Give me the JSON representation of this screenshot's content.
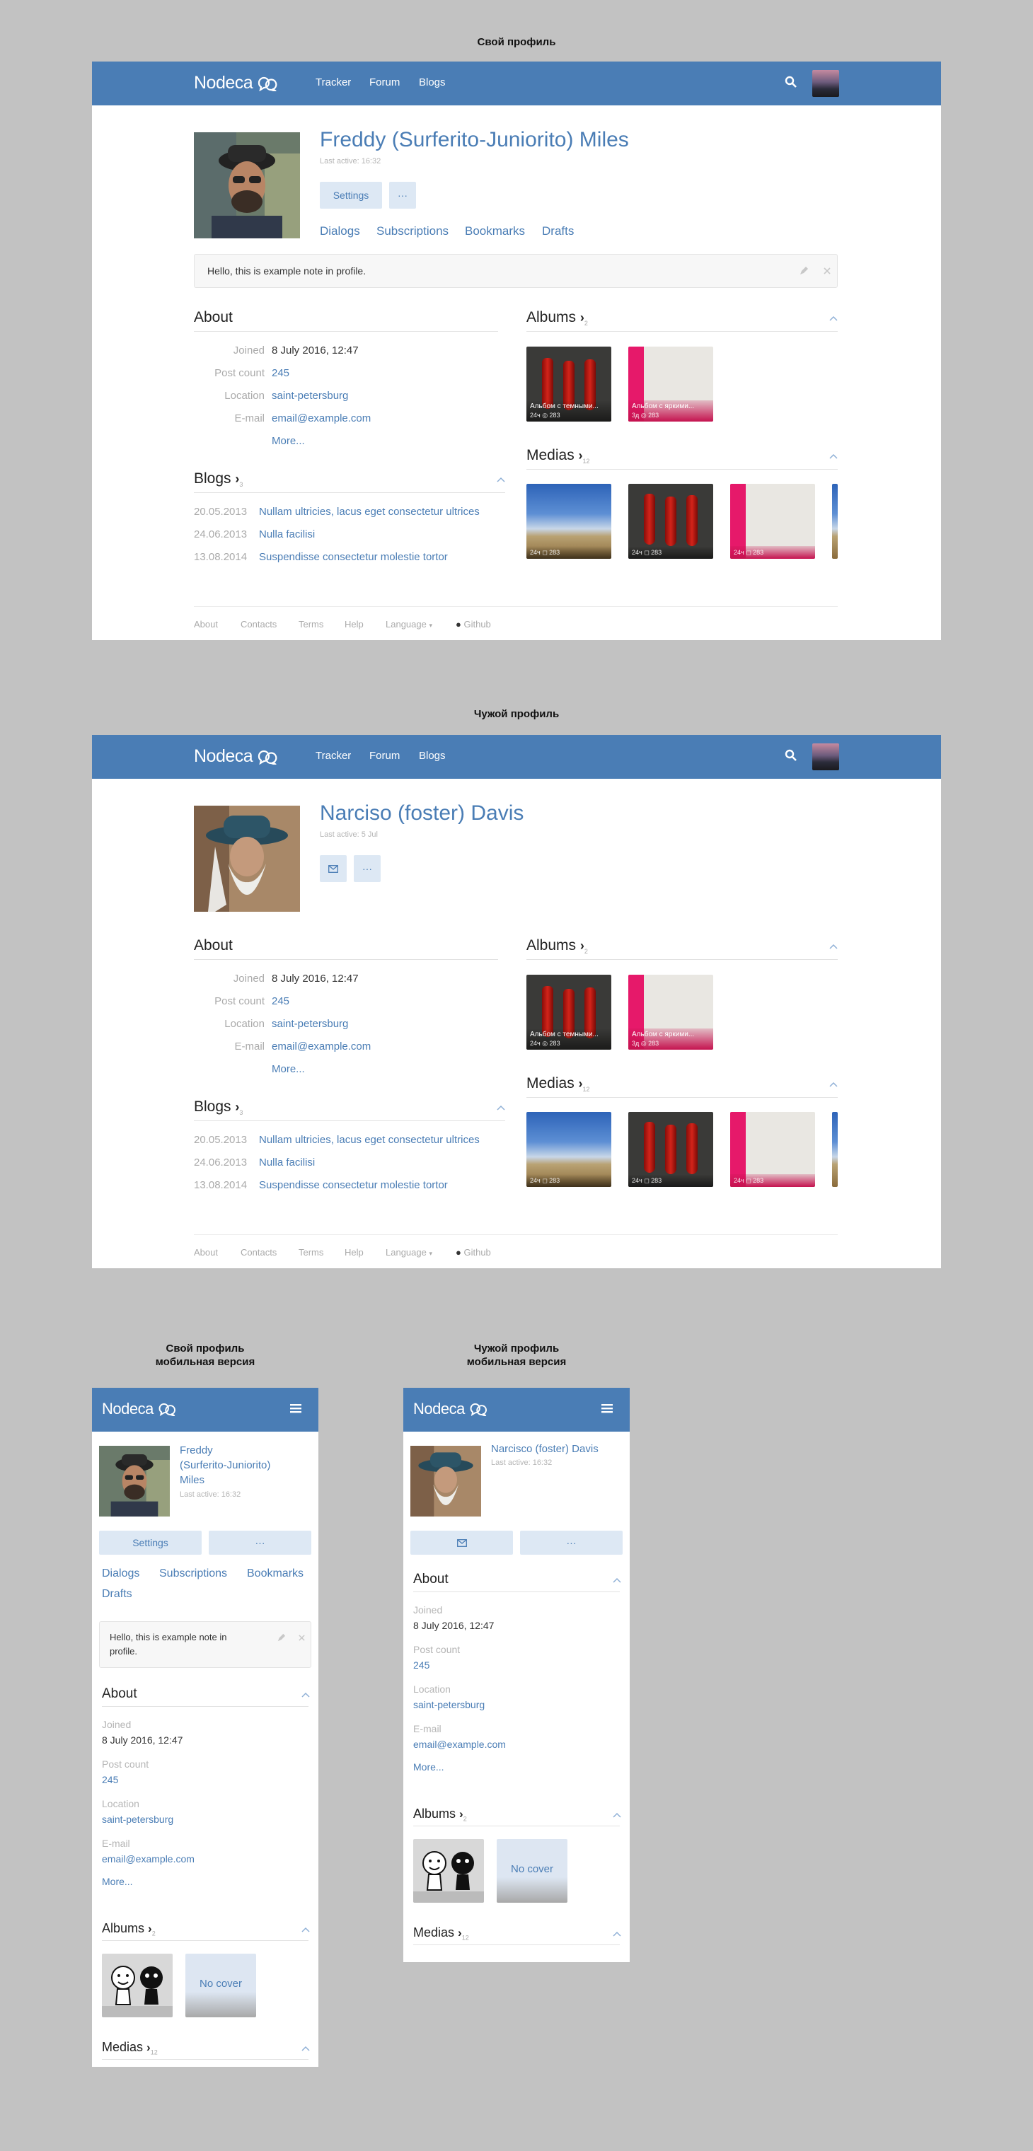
{
  "captions": {
    "own": "Свой профиль",
    "other": "Чужой профиль",
    "own_mobile_1": "Свой профиль",
    "own_mobile_2": "мобильная версия",
    "other_mobile_1": "Чужой профиль",
    "other_mobile_2": "мобильная версия"
  },
  "nav": {
    "logo": "Nodeca",
    "links": [
      "Tracker",
      "Forum",
      "Blogs"
    ],
    "icons": [
      "search-icon",
      "menu-icon"
    ]
  },
  "own": {
    "name": "Freddy (Surferito-Juniorito) Miles",
    "mobile_name": [
      "Freddy",
      "(Surferito-Juniorito)",
      "Miles"
    ],
    "last_active": "Last active: 16:32",
    "settings_label": "Settings",
    "more_label": "···",
    "tabs": [
      "Dialogs",
      "Subscriptions",
      "Bookmarks",
      "Drafts"
    ],
    "note": "Hello, this is example note in profile.",
    "mobile_note": [
      "Hello, this is example note in",
      "profile."
    ]
  },
  "other": {
    "name": "Narciso (foster) Davis",
    "last_active": "Last active: 5 Jul",
    "mobile_name": "Narcisco (foster) Davis",
    "mobile_last_active": "Last active: 16:32",
    "more_label": "···"
  },
  "about": {
    "title": "About",
    "rows": [
      {
        "label": "Joined",
        "value": "8 July 2016, 12:47",
        "link": false
      },
      {
        "label": "Post count",
        "value": "245",
        "link": true
      },
      {
        "label": "Location",
        "value": "saint-petersburg",
        "link": true
      },
      {
        "label": "E-mail",
        "value": "email@example.com",
        "link": true
      }
    ],
    "more": "More..."
  },
  "blogs": {
    "title": "Blogs",
    "count": "3",
    "items": [
      {
        "date": "20.05.2013",
        "title": "Nullam ultricies, lacus eget consectetur ultrices"
      },
      {
        "date": "24.06.2013",
        "title": "Nulla facilisi"
      },
      {
        "date": "13.08.2014",
        "title": "Suspendisse consectetur molestie tortor"
      }
    ]
  },
  "albums": {
    "title": "Albums",
    "count": "2",
    "items": [
      {
        "title": "Альбом с темными...",
        "meta": "24ч  ◎ 283"
      },
      {
        "title": "Альбом с яркими...",
        "meta": "3д  ◎ 283"
      }
    ],
    "no_cover": "No cover"
  },
  "medias": {
    "title": "Medias",
    "count": "12",
    "meta": [
      "24ч  ◻ 283",
      "24ч  ◻ 283",
      "24ч  ◻ 283"
    ]
  },
  "footer": {
    "links": [
      "About",
      "Contacts",
      "Terms",
      "Help",
      "Language"
    ],
    "github": "Github"
  },
  "colors": {
    "brand": "#4a7db5",
    "button_bg": "#dde8f4",
    "background": "#c2c2c2"
  }
}
